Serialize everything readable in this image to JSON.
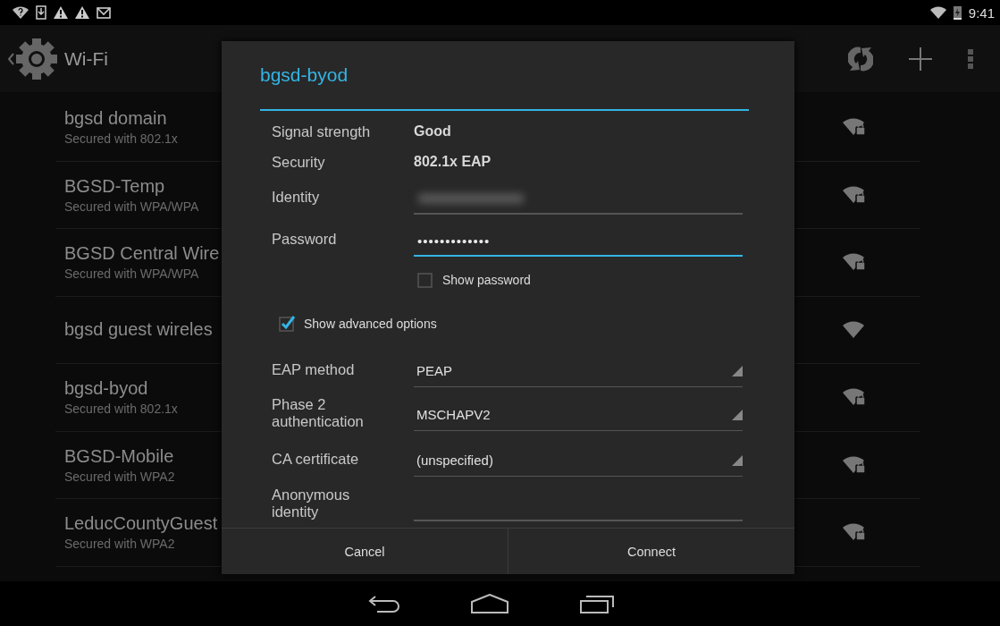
{
  "status_bar": {
    "time": "9:41"
  },
  "action_bar": {
    "title": "Wi-Fi"
  },
  "networks": [
    {
      "name": "bgsd domain",
      "subtitle": "Secured with 802.1x",
      "secured": true
    },
    {
      "name": "BGSD-Temp",
      "subtitle": "Secured with WPA/WPA",
      "secured": true
    },
    {
      "name": "BGSD Central Wire",
      "subtitle": "Secured with WPA/WPA",
      "secured": true
    },
    {
      "name": "bgsd guest wireles",
      "secured": false
    },
    {
      "name": "bgsd-byod",
      "subtitle": "Secured with 802.1x",
      "secured": true
    },
    {
      "name": "BGSD-Mobile",
      "subtitle": "Secured with WPA2",
      "secured": true
    },
    {
      "name": "LeducCountyGuest",
      "subtitle": "Secured with WPA2",
      "secured": true
    }
  ],
  "dialog": {
    "title": "bgsd-byod",
    "info": [
      {
        "label": "Signal strength",
        "value": "Good"
      },
      {
        "label": "Security",
        "value": "802.1x EAP"
      }
    ],
    "fields": [
      {
        "kind": "text",
        "label": "Identity",
        "blurred": true,
        "focused": false
      },
      {
        "kind": "text",
        "label": "Password",
        "value": "•••••••••••••",
        "focused": true
      }
    ],
    "show_password": {
      "label": "Show password",
      "checked": false
    },
    "show_advanced": {
      "label": "Show advanced options",
      "checked": true
    },
    "advanced": [
      {
        "kind": "dropdown",
        "label": "EAP method",
        "value": "PEAP"
      },
      {
        "kind": "dropdown",
        "label": "Phase 2 authentication",
        "value": "MSCHAPV2"
      },
      {
        "kind": "dropdown",
        "label": "CA certificate",
        "value": "(unspecified)"
      },
      {
        "kind": "text",
        "label": "Anonymous identity",
        "focused": false
      }
    ],
    "buttons": [
      {
        "label": "Cancel"
      },
      {
        "label": "Connect"
      }
    ]
  }
}
